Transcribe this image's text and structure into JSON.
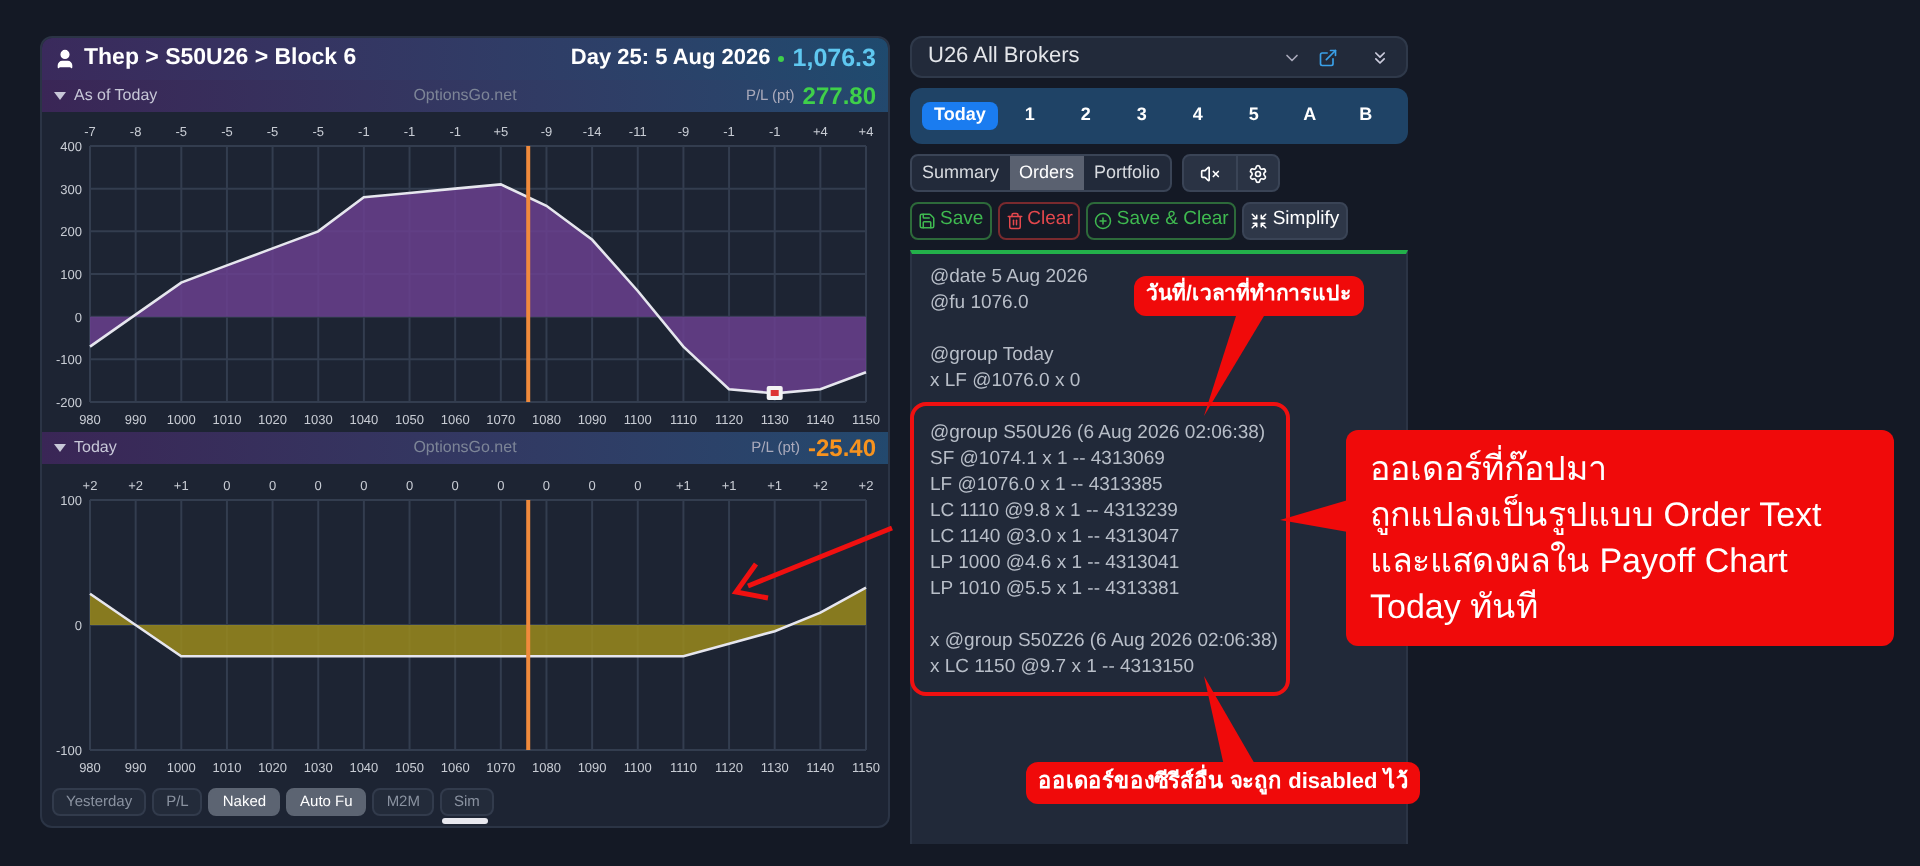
{
  "header": {
    "breadcrumb": "Thep > S50U26 > Block 6",
    "day": "Day 25: 5 Aug 2026",
    "price": "1,076.3"
  },
  "charts": [
    {
      "label": "As of Today",
      "watermark": "OptionsGo.net",
      "pl_label": "P/L (pt)",
      "pl_value": "277.80",
      "color": "#3fd04a",
      "top_labels": [
        "-7",
        "-8",
        "-5",
        "-5",
        "-5",
        "-5",
        "-1",
        "-1",
        "-1",
        "+5",
        "-9",
        "-14",
        "-11",
        "-9",
        "-1",
        "-1",
        "+4",
        "+4"
      ],
      "chart_data": {
        "type": "area",
        "x": [
          980,
          990,
          1000,
          1010,
          1020,
          1030,
          1040,
          1050,
          1060,
          1070,
          1080,
          1090,
          1100,
          1110,
          1120,
          1130,
          1140,
          1150
        ],
        "series": [
          {
            "color": "#6a3f8e",
            "values": [
              -70,
              5,
              80,
              120,
              160,
              200,
              280,
              290,
              300,
              310,
              260,
              180,
              60,
              -70,
              -170,
              -180,
              -170,
              -130
            ]
          }
        ],
        "xlim": [
          980,
          1150
        ],
        "ylim": [
          -200,
          400
        ],
        "xticks": [
          980,
          990,
          1000,
          1010,
          1020,
          1030,
          1040,
          1050,
          1060,
          1070,
          1080,
          1090,
          1100,
          1110,
          1120,
          1130,
          1140,
          1150
        ],
        "yticks": [
          -200,
          -100,
          0,
          100,
          200,
          300,
          400
        ],
        "grid": true,
        "ref_lines": [
          {
            "axis": "x",
            "value": 1076,
            "color": "#f08a3c"
          }
        ]
      }
    },
    {
      "label": "Today",
      "watermark": "OptionsGo.net",
      "pl_label": "P/L (pt)",
      "pl_value": "-25.40",
      "color": "#f7931e",
      "top_labels": [
        "+2",
        "+2",
        "+1",
        "0",
        "0",
        "0",
        "0",
        "0",
        "0",
        "0",
        "0",
        "0",
        "0",
        "+1",
        "+1",
        "+1",
        "+2",
        "+2"
      ],
      "chart_data": {
        "type": "area",
        "x": [
          980,
          990,
          1000,
          1010,
          1020,
          1030,
          1040,
          1050,
          1060,
          1070,
          1080,
          1090,
          1100,
          1110,
          1120,
          1130,
          1140,
          1150
        ],
        "series": [
          {
            "color": "#9a8a1c",
            "values": [
              25,
              0,
              -25,
              -25,
              -25,
              -25,
              -25,
              -25,
              -25,
              -25,
              -25,
              -25,
              -25,
              -25,
              -15,
              -5,
              10,
              30
            ]
          }
        ],
        "xlim": [
          980,
          1150
        ],
        "ylim": [
          -100,
          100
        ],
        "xticks": [
          980,
          990,
          1000,
          1010,
          1020,
          1030,
          1040,
          1050,
          1060,
          1070,
          1080,
          1090,
          1100,
          1110,
          1120,
          1130,
          1140,
          1150
        ],
        "yticks": [
          -100,
          0,
          100
        ],
        "grid": true,
        "ref_lines": [
          {
            "axis": "x",
            "value": 1076,
            "color": "#f08a3c"
          }
        ]
      }
    }
  ],
  "chart_toggles": [
    {
      "label": "Yesterday",
      "selected": false
    },
    {
      "label": "P/L",
      "selected": false
    },
    {
      "label": "Naked",
      "selected": true
    },
    {
      "label": "Auto Fu",
      "selected": true
    },
    {
      "label": "M2M",
      "selected": false
    },
    {
      "label": "Sim",
      "selected": false
    }
  ],
  "broker_select": {
    "value": "U26 All Brokers"
  },
  "day_tabs": [
    {
      "label": "Today",
      "selected": true
    },
    {
      "label": "1",
      "selected": false
    },
    {
      "label": "2",
      "selected": false
    },
    {
      "label": "3",
      "selected": false
    },
    {
      "label": "4",
      "selected": false
    },
    {
      "label": "5",
      "selected": false
    },
    {
      "label": "A",
      "selected": false
    },
    {
      "label": "B",
      "selected": false
    }
  ],
  "view_tabs": [
    {
      "label": "Summary",
      "selected": false
    },
    {
      "label": "Orders",
      "selected": true
    },
    {
      "label": "Portfolio",
      "selected": false
    }
  ],
  "actions": [
    {
      "label": "Save",
      "kind": "save"
    },
    {
      "label": "Clear",
      "kind": "clear"
    },
    {
      "label": "Save & Clear",
      "kind": "save_clear"
    },
    {
      "label": "Simplify",
      "kind": "simplify"
    }
  ],
  "order_text": [
    [
      "@date 5 Aug 2026",
      "@fu 1076.0"
    ],
    [
      "@group Today",
      "x LF @1076.0 x 0"
    ],
    [
      "@group S50U26 (6 Aug 2026 02:06:38)",
      "SF @1074.1 x 1 -- 4313069",
      "LF @1076.0 x 1 -- 4313385",
      "LC 1110 @9.8 x 1 -- 4313239",
      "LC 1140 @3.0 x 1 -- 4313047",
      "LP 1000 @4.6 x 1 -- 4313041",
      "LP 1010 @5.5 x 1 -- 4313381"
    ],
    [
      "x @group S50Z26 (6 Aug 2026 02:06:38)",
      "x LC 1150 @9.7 x 1 -- 4313150"
    ]
  ],
  "callouts": [
    {
      "text": "วันที่/เวลาที่ทำการแปะ",
      "kind": "small"
    },
    {
      "text": "ออเดอร์ที่ก๊อปมา\nถูกแปลงเป็นรูปแบบ Order Text\nและแสดงผลใน Payoff Chart\nToday ทันที",
      "kind": "large"
    },
    {
      "text": "ออเดอร์ของซีรีส์อื่น จะถูก disabled ไว้",
      "kind": "bottom"
    }
  ]
}
